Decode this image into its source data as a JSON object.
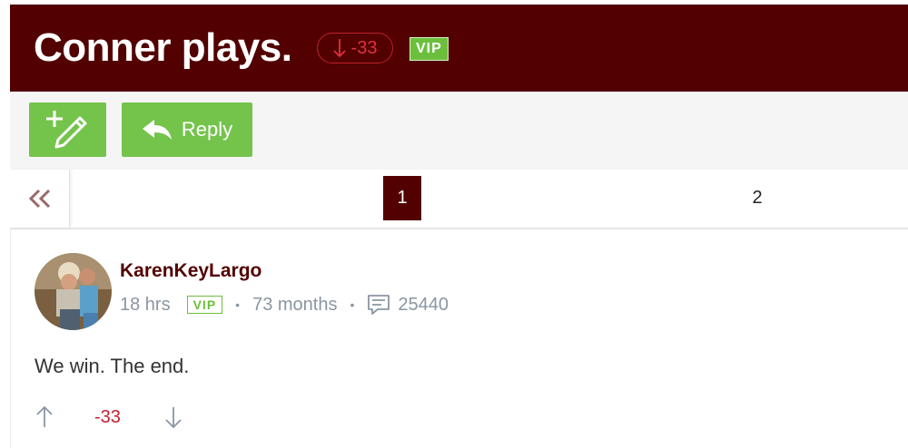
{
  "header": {
    "title": "Conner plays.",
    "score": "-33",
    "badge": "VIP",
    "bg_color": "#520000"
  },
  "toolbar": {
    "new_icon": "pencil-plus-icon",
    "reply_icon": "reply-arrow-icon",
    "reply_label": "Reply",
    "button_color": "#74c44c"
  },
  "pagination": {
    "first_icon": "double-chevron-left-icon",
    "current_page": "1",
    "next_page": "2"
  },
  "post": {
    "username": "KarenKeyLargo",
    "time": "18 hrs",
    "badge": "VIP",
    "membership": "73 months",
    "separator": "•",
    "posts_icon": "comment-icon",
    "post_count": "25440",
    "body": "We win. The end.",
    "score": "-33",
    "up_icon": "arrow-up-icon",
    "down_icon": "arrow-down-icon"
  }
}
